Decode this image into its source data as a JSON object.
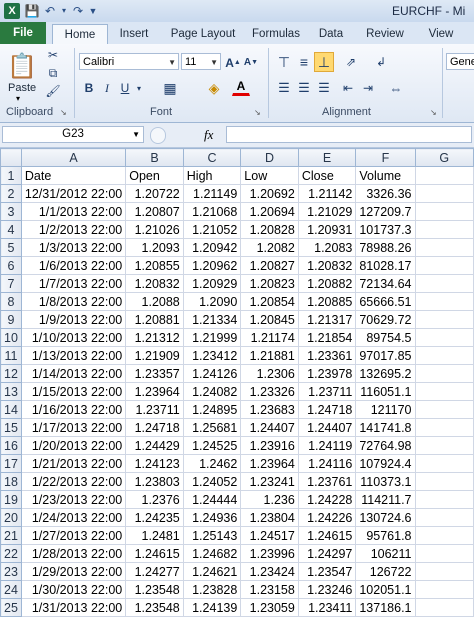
{
  "window": {
    "title": "EURCHF - Mi",
    "app_icon": "X"
  },
  "tabs": [
    "File",
    "Home",
    "Insert",
    "Page Layout",
    "Formulas",
    "Data",
    "Review",
    "View"
  ],
  "ribbon": {
    "paste_label": "Paste",
    "clipboard_label": "Clipboard",
    "font_label": "Font",
    "alignment_label": "Alignment",
    "font_name": "Calibri",
    "font_size": "11",
    "number_format": "Gene"
  },
  "formula_bar": {
    "name_box": "G23",
    "fx_label": "fx",
    "formula": ""
  },
  "columns": [
    "A",
    "B",
    "C",
    "D",
    "E",
    "F",
    "G"
  ],
  "rows": [
    [
      "Date",
      "Open",
      "High",
      "Low",
      "Close",
      "Volume"
    ],
    [
      "12/31/2012 22:00",
      "1.20722",
      "1.21149",
      "1.20692",
      "1.21142",
      "3326.36"
    ],
    [
      "1/1/2013 22:00",
      "1.20807",
      "1.21068",
      "1.20694",
      "1.21029",
      "127209.7"
    ],
    [
      "1/2/2013 22:00",
      "1.21026",
      "1.21052",
      "1.20828",
      "1.20931",
      "101737.3"
    ],
    [
      "1/3/2013 22:00",
      "1.2093",
      "1.20942",
      "1.2082",
      "1.2083",
      "78988.26"
    ],
    [
      "1/6/2013 22:00",
      "1.20855",
      "1.20962",
      "1.20827",
      "1.20832",
      "81028.17"
    ],
    [
      "1/7/2013 22:00",
      "1.20832",
      "1.20929",
      "1.20823",
      "1.20882",
      "72134.64"
    ],
    [
      "1/8/2013 22:00",
      "1.2088",
      "1.2090",
      "1.20854",
      "1.20885",
      "65666.51"
    ],
    [
      "1/9/2013 22:00",
      "1.20881",
      "1.21334",
      "1.20845",
      "1.21317",
      "70629.72"
    ],
    [
      "1/10/2013 22:00",
      "1.21312",
      "1.21999",
      "1.21174",
      "1.21854",
      "89754.5"
    ],
    [
      "1/13/2013 22:00",
      "1.21909",
      "1.23412",
      "1.21881",
      "1.23361",
      "97017.85"
    ],
    [
      "1/14/2013 22:00",
      "1.23357",
      "1.24126",
      "1.2306",
      "1.23978",
      "132695.2"
    ],
    [
      "1/15/2013 22:00",
      "1.23964",
      "1.24082",
      "1.23326",
      "1.23711",
      "116051.1"
    ],
    [
      "1/16/2013 22:00",
      "1.23711",
      "1.24895",
      "1.23683",
      "1.24718",
      "121170"
    ],
    [
      "1/17/2013 22:00",
      "1.24718",
      "1.25681",
      "1.24407",
      "1.24407",
      "141741.8"
    ],
    [
      "1/20/2013 22:00",
      "1.24429",
      "1.24525",
      "1.23916",
      "1.24119",
      "72764.98"
    ],
    [
      "1/21/2013 22:00",
      "1.24123",
      "1.2462",
      "1.23964",
      "1.24116",
      "107924.4"
    ],
    [
      "1/22/2013 22:00",
      "1.23803",
      "1.24052",
      "1.23241",
      "1.23761",
      "110373.1"
    ],
    [
      "1/23/2013 22:00",
      "1.2376",
      "1.24444",
      "1.236",
      "1.24228",
      "114211.7"
    ],
    [
      "1/24/2013 22:00",
      "1.24235",
      "1.24936",
      "1.23804",
      "1.24226",
      "130724.6"
    ],
    [
      "1/27/2013 22:00",
      "1.2481",
      "1.25143",
      "1.24517",
      "1.24615",
      "95761.8"
    ],
    [
      "1/28/2013 22:00",
      "1.24615",
      "1.24682",
      "1.23996",
      "1.24297",
      "106211"
    ],
    [
      "1/29/2013 22:00",
      "1.24277",
      "1.24621",
      "1.23424",
      "1.23547",
      "126722"
    ],
    [
      "1/30/2013 22:00",
      "1.23548",
      "1.23828",
      "1.23158",
      "1.23246",
      "102051.1"
    ],
    [
      "1/31/2013 22:00",
      "1.23548",
      "1.24139",
      "1.23059",
      "1.23411",
      "137186.1"
    ]
  ],
  "colors": {
    "file_tab": "#2a7a3f",
    "ribbon": "#dfe8f4",
    "header": "#dfe6f0",
    "selected_align": "#ffd971"
  }
}
